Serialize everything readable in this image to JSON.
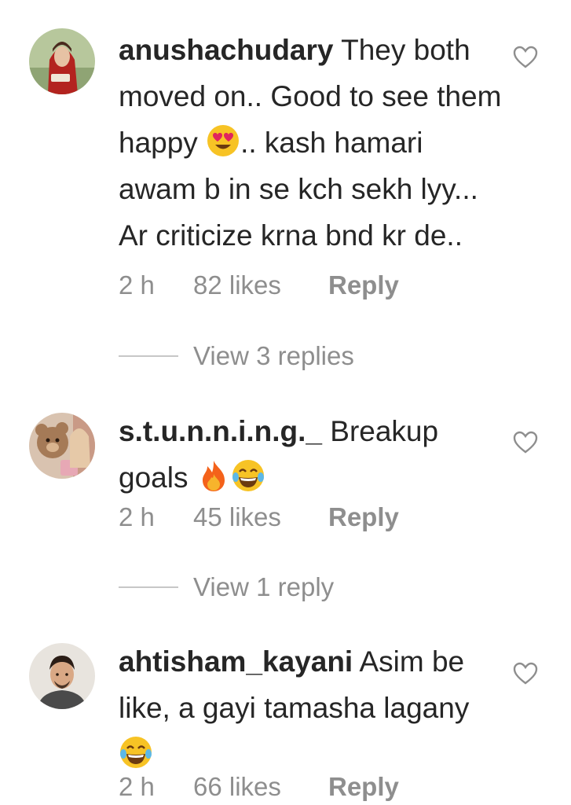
{
  "comments": [
    {
      "username": "anushachudary",
      "text_parts": [
        "They both moved on.. Good to see them happy ",
        ".. kash hamari awam b in se kch sekh lyy... Ar criticize krna bnd kr de.."
      ],
      "emojis": [
        "heart-eyes-emoji"
      ],
      "time": "2 h",
      "likes": "82 likes",
      "reply_label": "Reply",
      "view_replies": "View 3 replies"
    },
    {
      "username": "s.t.u.n.n.i.n.g._",
      "text_parts": [
        "Breakup goals "
      ],
      "emojis": [
        "fire-emoji",
        "tears-of-joy-emoji"
      ],
      "time": "2 h",
      "likes": "45 likes",
      "reply_label": "Reply",
      "view_replies": "View 1 reply"
    },
    {
      "username": "ahtisham_kayani",
      "text_parts": [
        "Asim be like, a gayi tamasha lagany "
      ],
      "emojis": [
        "tears-of-joy-emoji"
      ],
      "time": "2 h",
      "likes": "66 likes",
      "reply_label": "Reply"
    }
  ],
  "colors": {
    "text": "#262626",
    "secondary": "#8e8e8e",
    "divider": "#c7c7c7",
    "emoji_yellow": "#f7c325",
    "heart_eyes_red": "#e0245e",
    "fire_orange": "#f4621a"
  },
  "icons": {
    "like": "heart-outline-icon"
  }
}
